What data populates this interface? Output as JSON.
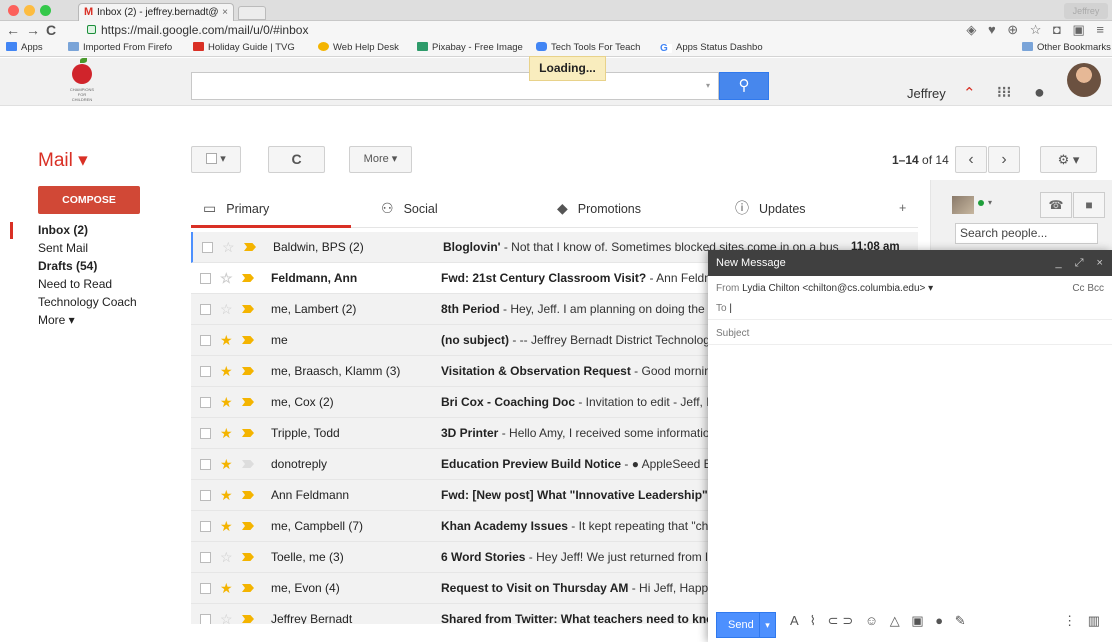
{
  "browser": {
    "tab_title": "Inbox (2) - jeffrey.bernadt@",
    "tab_close": "×",
    "profile_name": "Jeffrey",
    "url": "https://mail.google.com/mail/u/0/#inbox",
    "extension_icons": "◈ ♥ ⊕ ☆ ◘ ▣ ≡",
    "bookmarks": [
      {
        "label": "Apps",
        "color": "#4285f4"
      },
      {
        "label": "Imported From Firefo",
        "color": "#7aa4d8"
      },
      {
        "label": "Holiday Guide | TVG",
        "color": "#d93025"
      },
      {
        "label": "Web Help Desk",
        "color": "#f4b400"
      },
      {
        "label": "Pixabay - Free Image",
        "color": "#2e9b6a"
      },
      {
        "label": "Tech Tools For Teach",
        "color": "#4285f4"
      },
      {
        "label": "Apps Status Dashbo",
        "color": "#ffffff"
      }
    ],
    "other_bookmarks": "Other Bookmarks"
  },
  "header": {
    "logo_text": "CHAMPIONS\nFOR\nCHILDREN",
    "loading": "Loading...",
    "user": "Jeffrey",
    "icons": {
      "notifications": "⌃",
      "apps": "⁝⁝⁝",
      "circle": "●"
    }
  },
  "mail_bar": {
    "title": "Mail ▾",
    "select_dropdown": "▾",
    "refresh": "C",
    "more": "More ▾",
    "page_range": "1–14",
    "of_label": "of 14",
    "prev": "‹",
    "next": "›",
    "settings": "⚙ ▾"
  },
  "sidebar": {
    "compose": "COMPOSE",
    "items": [
      {
        "label": "Inbox (2)",
        "bold": true
      },
      {
        "label": "Sent Mail",
        "bold": false
      },
      {
        "label": "Drafts (54)",
        "bold": true
      },
      {
        "label": "Need to Read",
        "bold": false
      },
      {
        "label": "Technology Coach",
        "bold": false
      },
      {
        "label": "More ▾",
        "bold": false
      }
    ]
  },
  "tabs": [
    {
      "label": "Primary",
      "icon": "▭"
    },
    {
      "label": "Social",
      "icon": "⚇"
    },
    {
      "label": "Promotions",
      "icon": "◆"
    },
    {
      "label": "Updates",
      "icon": "ⓘ"
    },
    {
      "label": "+",
      "icon": ""
    }
  ],
  "emails": [
    {
      "sender": "Baldwin, BPS (2)",
      "subject": "Bloglovin'",
      "snippet": " - Not that I know of. Sometimes blocked sites come in on a bus",
      "time": "11:08 am",
      "unread": false,
      "starred": false,
      "important": true
    },
    {
      "sender": "Feldmann, Ann",
      "subject": "Fwd: 21st Century Classroom Visit?",
      "snippet": " - Ann Feldm",
      "time": "",
      "unread": true,
      "starred": false,
      "important": true
    },
    {
      "sender": "me, Lambert (2)",
      "subject": "8th Period",
      "snippet": " - Hey, Jeff. I am planning on doing the My",
      "time": "",
      "unread": false,
      "starred": false,
      "important": true
    },
    {
      "sender": "me",
      "subject": "(no subject)",
      "snippet": " - -- Jeffrey Bernadt District Technology",
      "time": "",
      "unread": false,
      "starred": true,
      "important": true
    },
    {
      "sender": "me, Braasch, Klamm (3)",
      "subject": "Visitation & Observation Request",
      "snippet": " - Good morning! T",
      "time": "",
      "unread": false,
      "starred": true,
      "important": true
    },
    {
      "sender": "me, Cox (2)",
      "subject": "Bri Cox - Coaching Doc",
      "snippet": " - Invitation to edit - Jeff, I fin",
      "time": "",
      "unread": false,
      "starred": true,
      "important": true
    },
    {
      "sender": "Tripple, Todd",
      "subject": "3D Printer",
      "snippet": " - Hello Amy, I received some information",
      "time": "",
      "unread": false,
      "starred": true,
      "important": true
    },
    {
      "sender": "donotreply",
      "subject": "Education Preview Build Notice",
      "snippet": " - ● AppleSeed Build",
      "time": "",
      "unread": false,
      "starred": true,
      "important": false
    },
    {
      "sender": "Ann Feldmann",
      "subject": "Fwd: [New post] What \"Innovative Leadership\" Look",
      "snippet": "",
      "time": "",
      "unread": false,
      "starred": true,
      "important": true
    },
    {
      "sender": "me, Campbell (7)",
      "subject": "Khan Academy Issues",
      "snippet": " - It kept repeating that \"chang",
      "time": "",
      "unread": false,
      "starred": true,
      "important": true
    },
    {
      "sender": "Toelle, me (3)",
      "subject": "6 Word Stories",
      "snippet": " - Hey Jeff! We just returned from lun",
      "time": "",
      "unread": false,
      "starred": false,
      "important": true
    },
    {
      "sender": "me, Evon (4)",
      "subject": "Request to Visit on Thursday AM",
      "snippet": " - Hi Jeff, Happy N",
      "time": "",
      "unread": false,
      "starred": true,
      "important": true
    },
    {
      "sender": "Jeffrey Bernadt",
      "subject": "Shared from Twitter: What teachers need to know al",
      "snippet": "",
      "time": "",
      "unread": false,
      "starred": false,
      "important": true
    }
  ],
  "people": {
    "search_placeholder": "Search people...",
    "call_icon": "☎",
    "video_icon": "■"
  },
  "compose_window": {
    "title": "New Message",
    "controls": "_ ⤢ ×",
    "from_label": "From",
    "from_value": "Lydia Chilton <chilton@cs.columbia.edu> ▾",
    "cc_bcc": "Cc Bcc",
    "to_label": "To",
    "subject_placeholder": "Subject",
    "send": "Send",
    "send_dropdown": "▾",
    "format_icons": "A ⌇ ⊂⊃ ☺ △ ▣ ● ✎",
    "more_icons": "⋮ ▥"
  }
}
